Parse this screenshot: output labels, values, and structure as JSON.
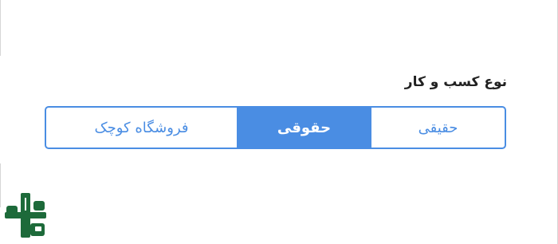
{
  "business_type": {
    "label": "نوع کسب و کار",
    "options": [
      "حقیقی",
      "حقوقی",
      "فروشگاه کوچک"
    ],
    "selected_index": 1,
    "accent_color": "#4a8de3"
  },
  "logo": {
    "icon": "brand-logo-icon",
    "color": "#1d6a3a"
  }
}
